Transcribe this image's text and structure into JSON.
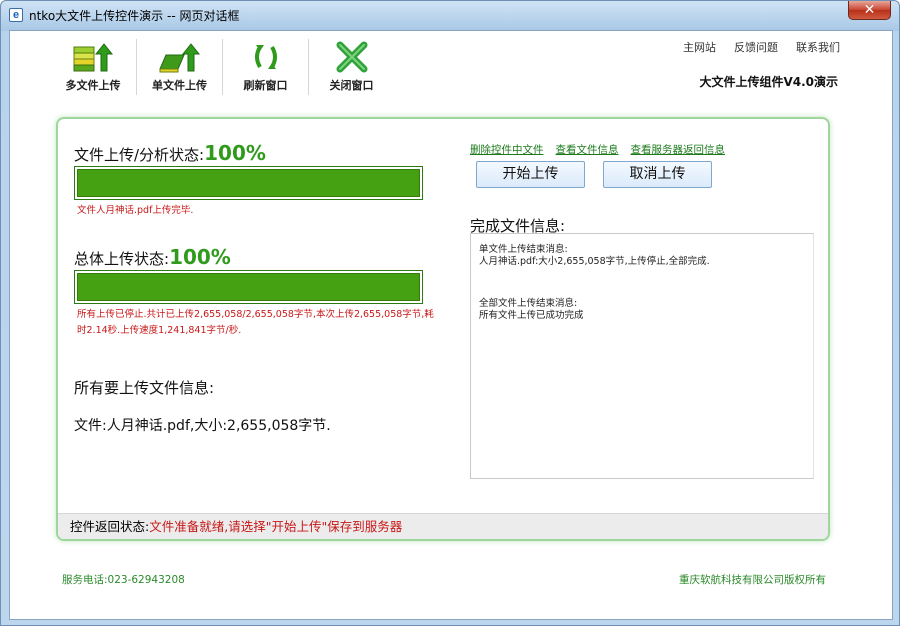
{
  "window": {
    "title": "ntko大文件上传控件演示 -- 网页对话框",
    "close_glyph": "✕"
  },
  "toolbar": {
    "items": [
      {
        "label": "多文件上传",
        "icon": "multi-upload-icon"
      },
      {
        "label": "单文件上传",
        "icon": "single-upload-icon"
      },
      {
        "label": "刷新窗口",
        "icon": "refresh-icon"
      },
      {
        "label": "关闭窗口",
        "icon": "close-window-icon"
      }
    ]
  },
  "top_links": [
    "主网站",
    "反馈问题",
    "联系我们"
  ],
  "app_title": "大文件上传组件V4.0演示",
  "file_status": {
    "label": "文件上传/分析状态:",
    "percent_text": "100%",
    "progress": 1.0,
    "message": "文件人月神话.pdf上传完毕."
  },
  "total_status": {
    "label": "总体上传状态:",
    "percent_text": "100%",
    "progress": 1.0,
    "message_line1": "所有上传已停止.共计已上传2,655,058/2,655,058字节,本次上传2,655,058字节,耗",
    "message_line2": "时2.14秒.上传速度1,241,841字节/秒."
  },
  "all_files": {
    "label": "所有要上传文件信息:",
    "entry": "文件:人月神话.pdf,大小:2,655,058字节."
  },
  "right_links": [
    "删除控件中文件",
    "查看文件信息",
    "查看服务器返回信息"
  ],
  "buttons": {
    "start": "开始上传",
    "cancel": "取消上传"
  },
  "done": {
    "label": "完成文件信息:",
    "line1": "单文件上传结束消息:",
    "line2": "人月神话.pdf:大小2,655,058字节,上传停止,全部完成.",
    "line3": "全部文件上传结束消息:",
    "line4": "所有文件上传已成功完成"
  },
  "statusbar": {
    "label": "控件返回状态:",
    "value": "文件准备就绪,请选择\"开始上传\"保存到服务器"
  },
  "footer": {
    "phone": "服务电话:023-62943208",
    "copyright": "重庆软航科技有限公司版权所有"
  },
  "colors": {
    "progress_fill": "#46a112",
    "accent_green": "#2f9a1b",
    "error_red": "#c81818"
  }
}
